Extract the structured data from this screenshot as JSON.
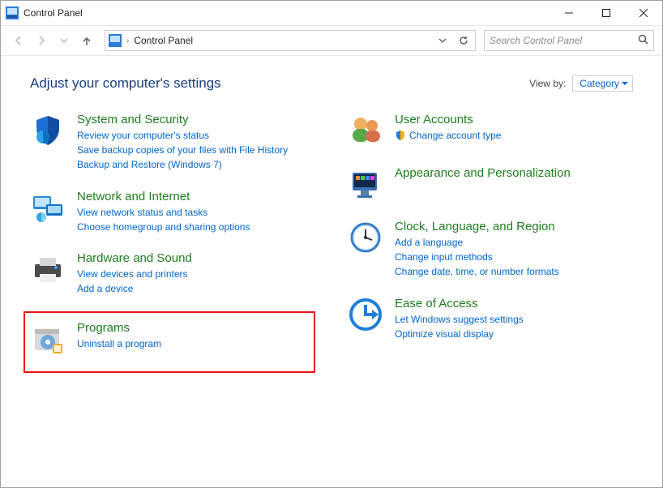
{
  "titlebar": {
    "title": "Control Panel"
  },
  "breadcrumb": {
    "root": "Control Panel"
  },
  "search": {
    "placeholder": "Search Control Panel"
  },
  "header": {
    "heading": "Adjust your computer's settings",
    "viewby_label": "View by:",
    "viewby_value": "Category"
  },
  "left": [
    {
      "title": "System and Security",
      "links": [
        "Review your computer's status",
        "Save backup copies of your files with File History",
        "Backup and Restore (Windows 7)"
      ]
    },
    {
      "title": "Network and Internet",
      "links": [
        "View network status and tasks",
        "Choose homegroup and sharing options"
      ]
    },
    {
      "title": "Hardware and Sound",
      "links": [
        "View devices and printers",
        "Add a device"
      ]
    },
    {
      "title": "Programs",
      "links": [
        "Uninstall a program"
      ]
    }
  ],
  "right": [
    {
      "title": "User Accounts",
      "links": [
        "Change account type"
      ],
      "shield": true
    },
    {
      "title": "Appearance and Personalization",
      "links": []
    },
    {
      "title": "Clock, Language, and Region",
      "links": [
        "Add a language",
        "Change input methods",
        "Change date, time, or number formats"
      ]
    },
    {
      "title": "Ease of Access",
      "links": [
        "Let Windows suggest settings",
        "Optimize visual display"
      ]
    }
  ]
}
